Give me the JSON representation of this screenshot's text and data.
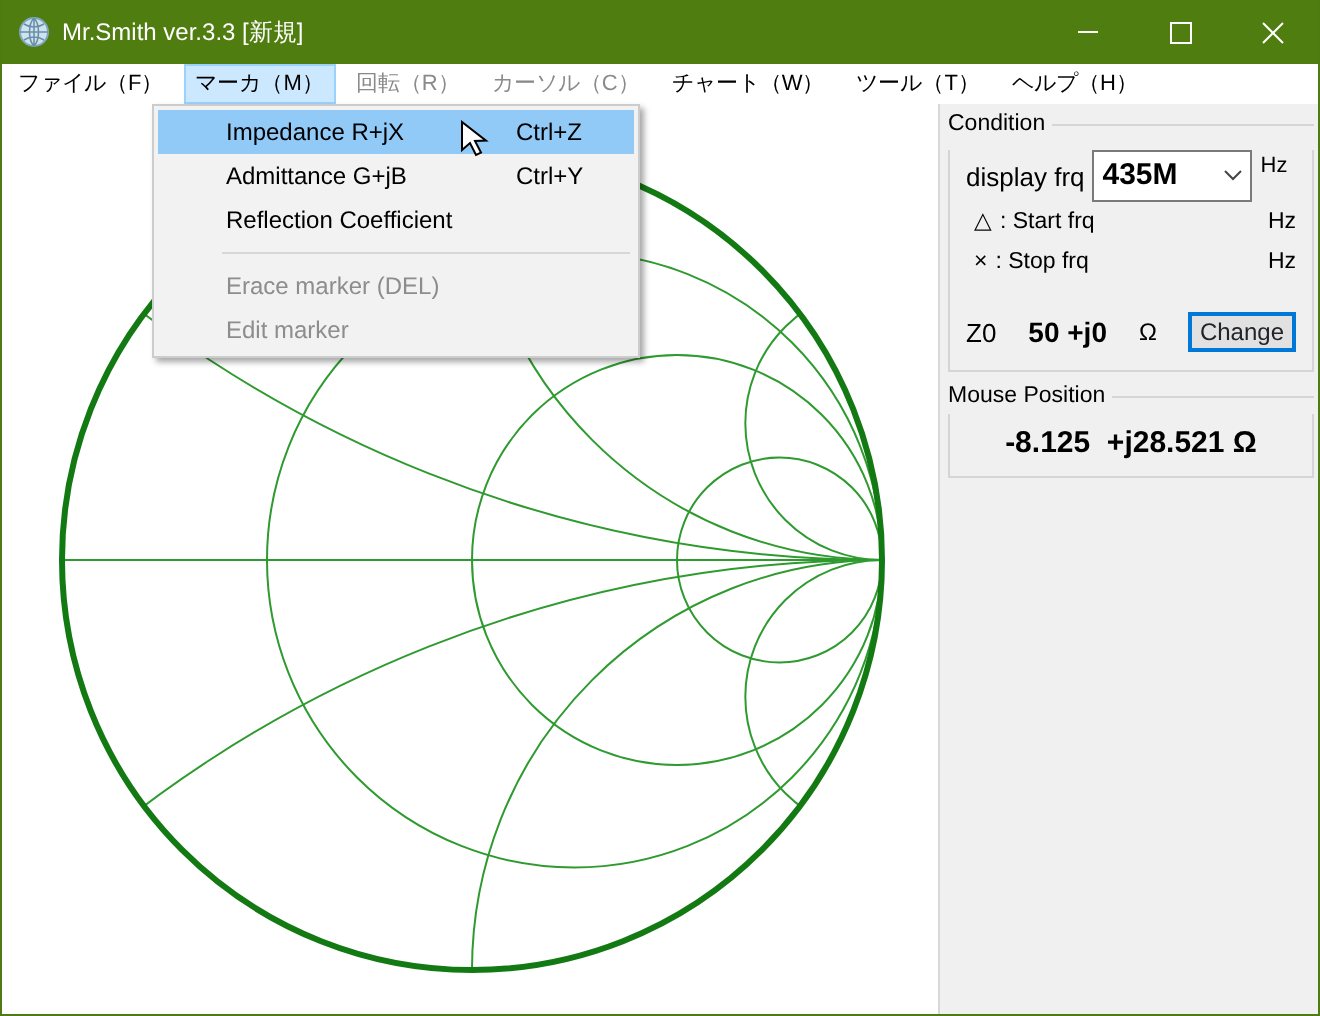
{
  "window": {
    "title": "Mr.Smith ver.3.3 [新規]"
  },
  "menu_bar": [
    {
      "label": "ファイル（F）",
      "selected": false,
      "disabled": false
    },
    {
      "label": "マーカ（M）",
      "selected": true,
      "disabled": false
    },
    {
      "label": "回転（R）",
      "selected": false,
      "disabled": true
    },
    {
      "label": "カーソル（C）",
      "selected": false,
      "disabled": true
    },
    {
      "label": "チャート（W）",
      "selected": false,
      "disabled": false
    },
    {
      "label": "ツール（T）",
      "selected": false,
      "disabled": false
    },
    {
      "label": "ヘルプ（H）",
      "selected": false,
      "disabled": false
    }
  ],
  "dropdown_menu": [
    {
      "kind": "item",
      "label": "Impedance R+jX",
      "shortcut": "Ctrl+Z",
      "selected": true,
      "disabled": false
    },
    {
      "kind": "item",
      "label": "Admittance G+jB",
      "shortcut": "Ctrl+Y",
      "selected": false,
      "disabled": false
    },
    {
      "kind": "item",
      "label": "Reflection Coefficient",
      "selected": false,
      "disabled": false
    },
    {
      "kind": "separator"
    },
    {
      "kind": "item",
      "label": "Erace marker (DEL)",
      "selected": false,
      "disabled": true
    },
    {
      "kind": "item",
      "label": "Edit marker",
      "selected": false,
      "disabled": true
    }
  ],
  "condition": {
    "title": "Condition",
    "display_frq_label": "display frq",
    "display_frq": "435M",
    "display_frq_unit": "Hz",
    "rows": [
      {
        "symbol": "△",
        "label": ": Start frq",
        "unit": "Hz"
      },
      {
        "symbol": "×",
        "label": ": Stop frq",
        "unit": "Hz"
      }
    ],
    "z0_label": "Z0",
    "z0_value": "50 +j0",
    "z0_unit": "Ω",
    "change_button": "Change"
  },
  "mouse_position": {
    "title": "Mouse Position",
    "value": "-8.125  +j28.521 Ω"
  }
}
